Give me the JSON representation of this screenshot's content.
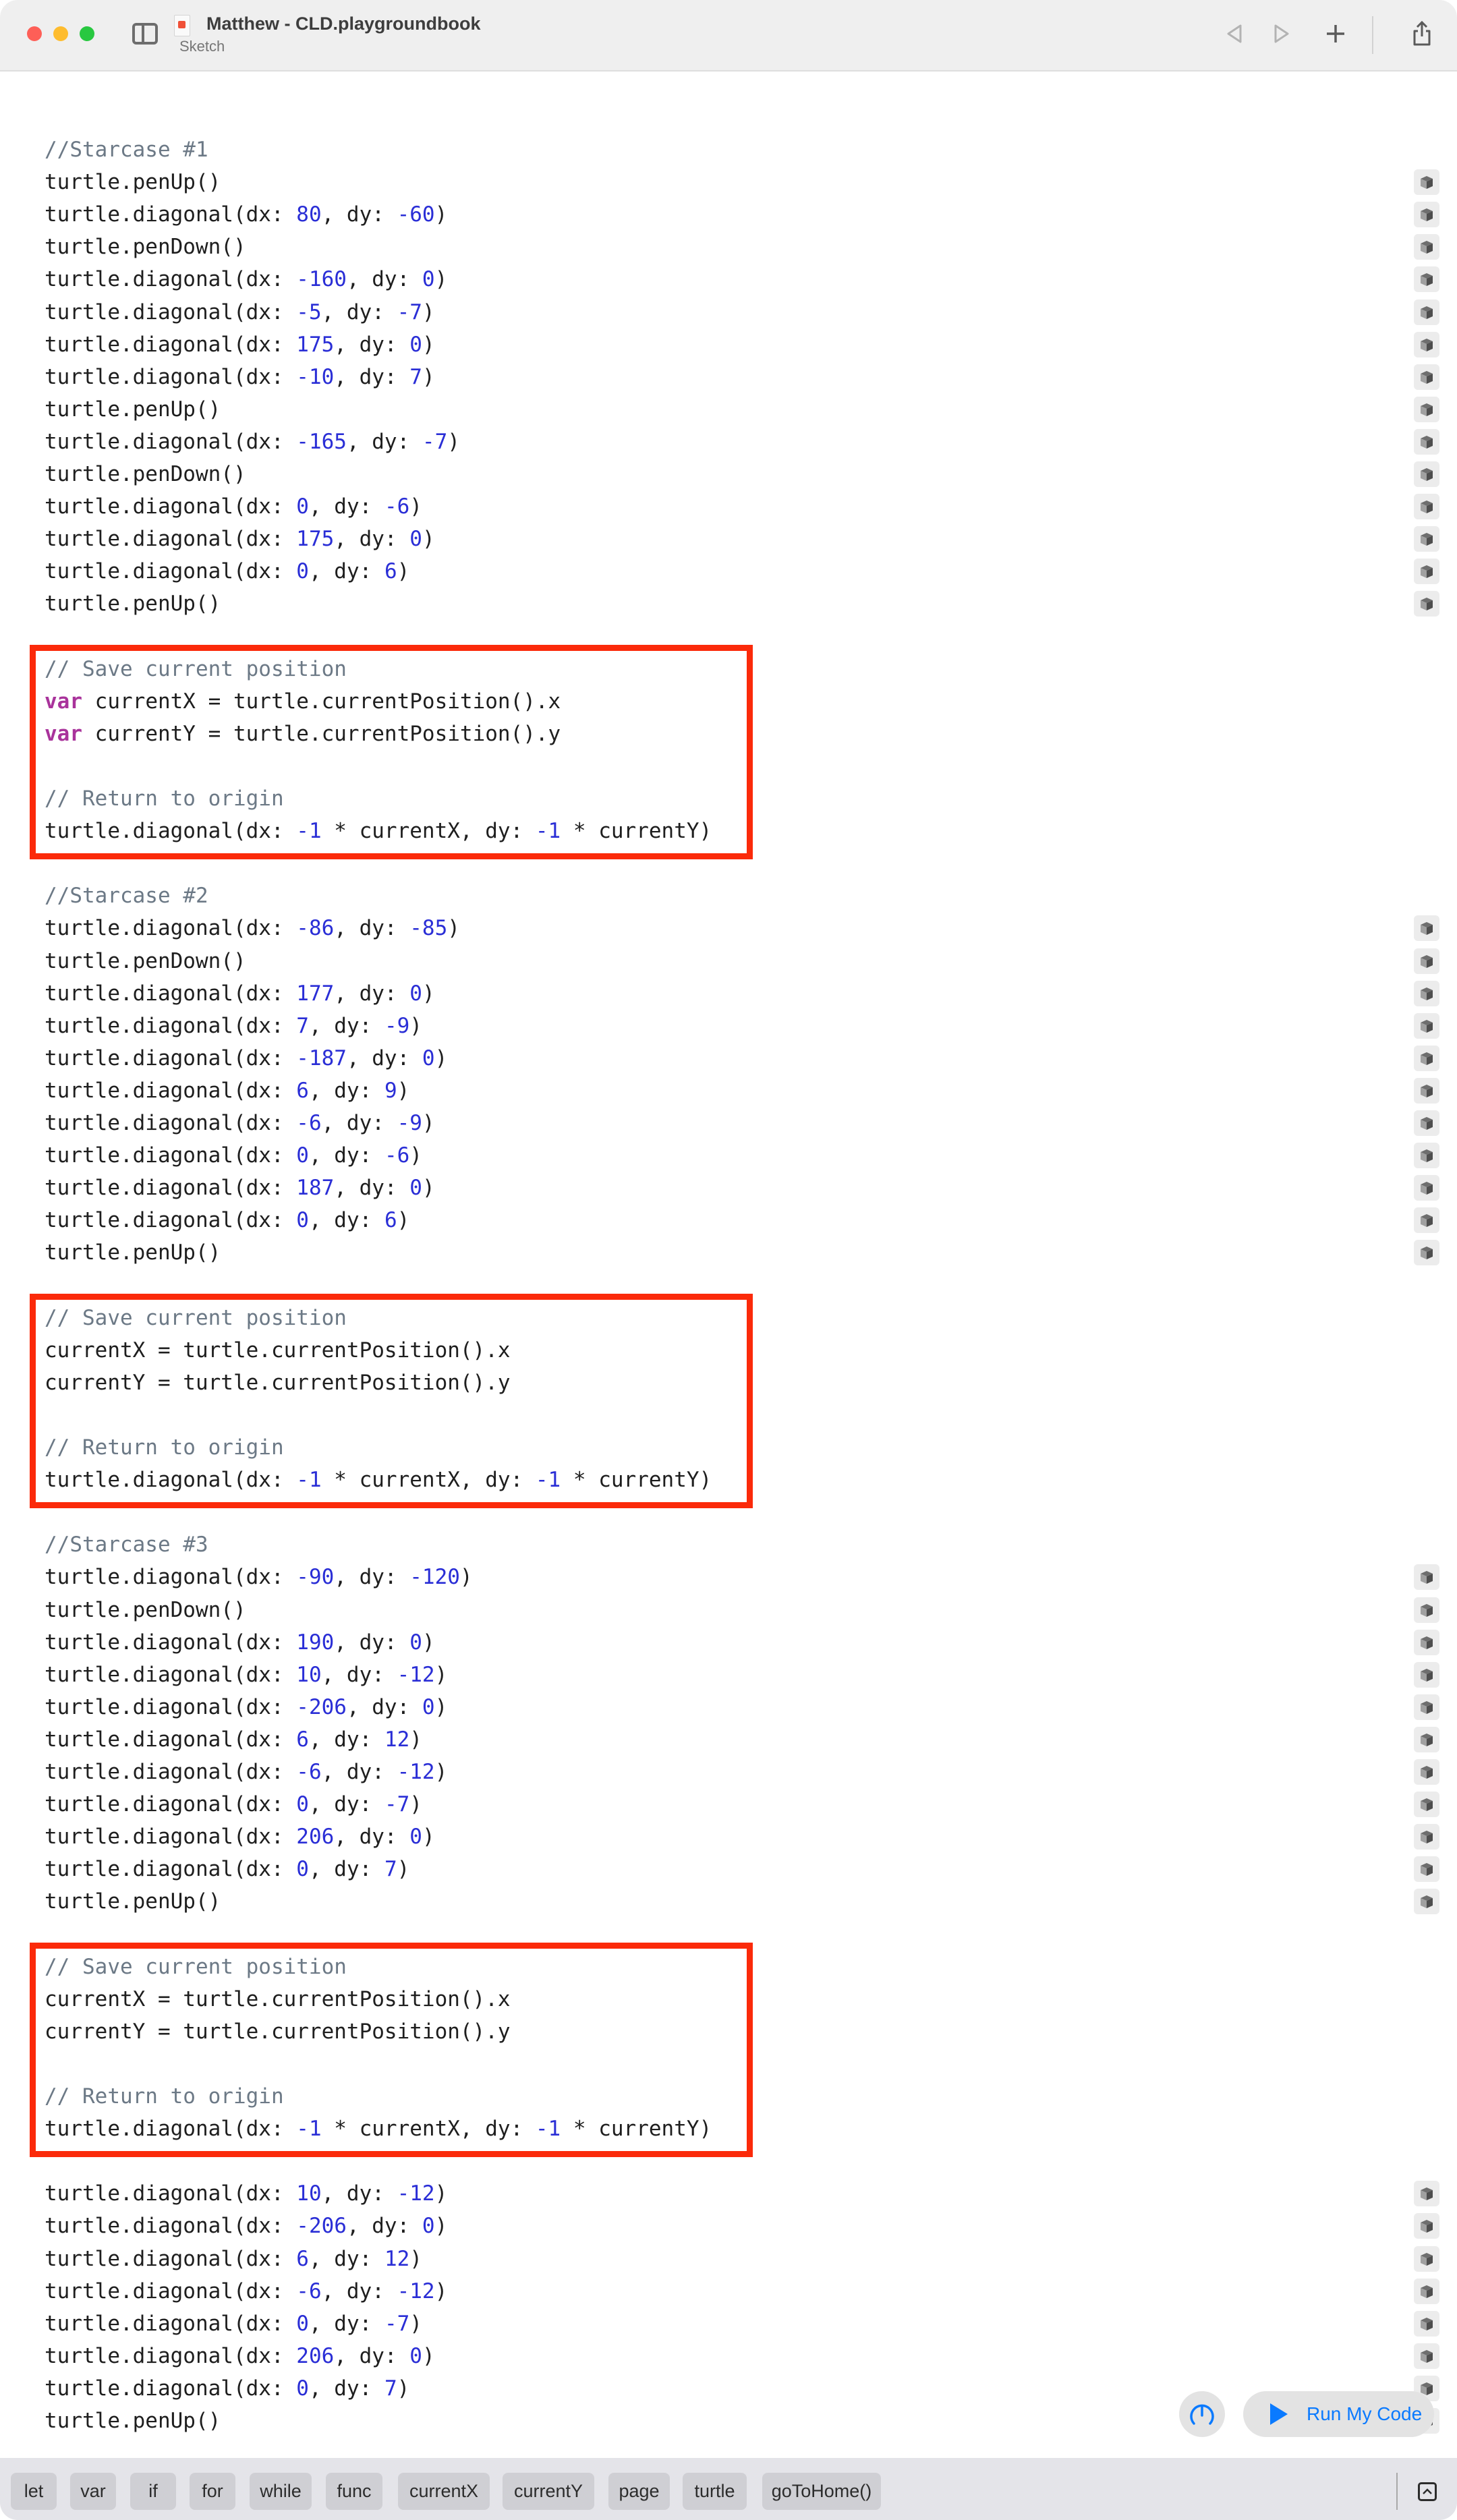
{
  "window": {
    "title": "Matthew - CLD.playgroundbook",
    "subtitle": "Sketch",
    "toolbar": {
      "back_icon": "triangle-left-icon",
      "forward_icon": "triangle-right-icon",
      "add_icon": "plus-icon",
      "share_icon": "share-icon"
    }
  },
  "code": {
    "lines": [
      {
        "kind": "comment",
        "text": "//Starcase #1",
        "result": false
      },
      {
        "kind": "call",
        "text": "turtle.penUp()",
        "result": true
      },
      {
        "kind": "diag",
        "dx": "80",
        "dy": "-60",
        "result": true
      },
      {
        "kind": "call",
        "text": "turtle.penDown()",
        "result": true
      },
      {
        "kind": "diag",
        "dx": "-160",
        "dy": "0",
        "result": true
      },
      {
        "kind": "diag",
        "dx": "-5",
        "dy": "-7",
        "result": true
      },
      {
        "kind": "diag",
        "dx": "175",
        "dy": "0",
        "result": true
      },
      {
        "kind": "diag",
        "dx": "-10",
        "dy": "7",
        "result": true
      },
      {
        "kind": "call",
        "text": "turtle.penUp()",
        "result": true
      },
      {
        "kind": "diag",
        "dx": "-165",
        "dy": "-7",
        "result": true
      },
      {
        "kind": "call",
        "text": "turtle.penDown()",
        "result": true
      },
      {
        "kind": "diag",
        "dx": "0",
        "dy": "-6",
        "result": true
      },
      {
        "kind": "diag",
        "dx": "175",
        "dy": "0",
        "result": true
      },
      {
        "kind": "diag",
        "dx": "0",
        "dy": "6",
        "result": true
      },
      {
        "kind": "call",
        "text": "turtle.penUp()",
        "result": true
      },
      {
        "kind": "blank"
      },
      {
        "kind": "comment",
        "text": "// Save current position",
        "result": false,
        "box_start": true
      },
      {
        "kind": "var",
        "kw": "var",
        "text": " currentX = turtle.currentPosition().x",
        "result": false
      },
      {
        "kind": "var",
        "kw": "var",
        "text": " currentY = turtle.currentPosition().y",
        "result": false
      },
      {
        "kind": "blank"
      },
      {
        "kind": "comment",
        "text": "// Return to origin",
        "result": false
      },
      {
        "kind": "origin",
        "result": false,
        "box_end": true
      },
      {
        "kind": "blank"
      },
      {
        "kind": "comment",
        "text": "//Starcase #2",
        "result": false
      },
      {
        "kind": "diag",
        "dx": "-86",
        "dy": "-85",
        "result": true
      },
      {
        "kind": "call",
        "text": "turtle.penDown()",
        "result": true
      },
      {
        "kind": "diag",
        "dx": "177",
        "dy": "0",
        "result": true
      },
      {
        "kind": "diag",
        "dx": "7",
        "dy": "-9",
        "result": true
      },
      {
        "kind": "diag",
        "dx": "-187",
        "dy": "0",
        "result": true
      },
      {
        "kind": "diag",
        "dx": "6",
        "dy": "9",
        "result": true
      },
      {
        "kind": "diag",
        "dx": "-6",
        "dy": "-9",
        "result": true
      },
      {
        "kind": "diag",
        "dx": "0",
        "dy": "-6",
        "result": true
      },
      {
        "kind": "diag",
        "dx": "187",
        "dy": "0",
        "result": true
      },
      {
        "kind": "diag",
        "dx": "0",
        "dy": "6",
        "result": true
      },
      {
        "kind": "call",
        "text": "turtle.penUp()",
        "result": true
      },
      {
        "kind": "blank"
      },
      {
        "kind": "comment",
        "text": "// Save current position",
        "result": false,
        "box_start": true
      },
      {
        "kind": "plain",
        "text": "currentX = turtle.currentPosition().x",
        "result": false
      },
      {
        "kind": "plain",
        "text": "currentY = turtle.currentPosition().y",
        "result": false
      },
      {
        "kind": "blank"
      },
      {
        "kind": "comment",
        "text": "// Return to origin",
        "result": false
      },
      {
        "kind": "origin",
        "result": false,
        "box_end": true
      },
      {
        "kind": "blank"
      },
      {
        "kind": "comment",
        "text": "//Starcase #3",
        "result": false
      },
      {
        "kind": "diag",
        "dx": "-90",
        "dy": "-120",
        "result": true
      },
      {
        "kind": "call",
        "text": "turtle.penDown()",
        "result": true
      },
      {
        "kind": "diag",
        "dx": "190",
        "dy": "0",
        "result": true
      },
      {
        "kind": "diag",
        "dx": "10",
        "dy": "-12",
        "result": true
      },
      {
        "kind": "diag",
        "dx": "-206",
        "dy": "0",
        "result": true
      },
      {
        "kind": "diag",
        "dx": "6",
        "dy": "12",
        "result": true
      },
      {
        "kind": "diag",
        "dx": "-6",
        "dy": "-12",
        "result": true
      },
      {
        "kind": "diag",
        "dx": "0",
        "dy": "-7",
        "result": true
      },
      {
        "kind": "diag",
        "dx": "206",
        "dy": "0",
        "result": true
      },
      {
        "kind": "diag",
        "dx": "0",
        "dy": "7",
        "result": true
      },
      {
        "kind": "call",
        "text": "turtle.penUp()",
        "result": true
      },
      {
        "kind": "blank"
      },
      {
        "kind": "comment",
        "text": "// Save current position",
        "result": false,
        "box_start": true
      },
      {
        "kind": "plain",
        "text": "currentX = turtle.currentPosition().x",
        "result": false
      },
      {
        "kind": "plain",
        "text": "currentY = turtle.currentPosition().y",
        "result": false
      },
      {
        "kind": "blank"
      },
      {
        "kind": "comment",
        "text": "// Return to origin",
        "result": false
      },
      {
        "kind": "origin",
        "result": false,
        "box_end": true
      },
      {
        "kind": "blank"
      },
      {
        "kind": "diag",
        "dx": "10",
        "dy": "-12",
        "result": true
      },
      {
        "kind": "diag",
        "dx": "-206",
        "dy": "0",
        "result": true
      },
      {
        "kind": "diag",
        "dx": "6",
        "dy": "12",
        "result": true
      },
      {
        "kind": "diag",
        "dx": "-6",
        "dy": "-12",
        "result": true
      },
      {
        "kind": "diag",
        "dx": "0",
        "dy": "-7",
        "result": true
      },
      {
        "kind": "diag",
        "dx": "206",
        "dy": "0",
        "result": true
      },
      {
        "kind": "diag",
        "dx": "0",
        "dy": "7",
        "result": true
      },
      {
        "kind": "call",
        "text": "turtle.penUp()",
        "result": true
      }
    ],
    "origin_call": {
      "prefix": "turtle.diagonal(dx: ",
      "n1": "-1",
      "mid1": " * currentX, dy: ",
      "n2": "-1",
      "mid2": " * currentY)"
    },
    "diag_parts": {
      "prefix": "turtle.diagonal(dx: ",
      "sep": ", dy: ",
      "suffix": ")"
    },
    "result_icon": "cube-icon",
    "highlight_color": "#fb2a0a"
  },
  "controls": {
    "meter_icon": "speedometer-icon",
    "run_label": "Run My Code",
    "run_icon": "play-icon",
    "accent_color": "#0a7aff"
  },
  "shortcuts": {
    "items": [
      "let",
      "var",
      "if",
      "for",
      "while",
      "func",
      "currentX",
      "currentY",
      "page",
      "turtle",
      "goToHome()"
    ],
    "collapse_icon": "chevron-up-icon"
  }
}
